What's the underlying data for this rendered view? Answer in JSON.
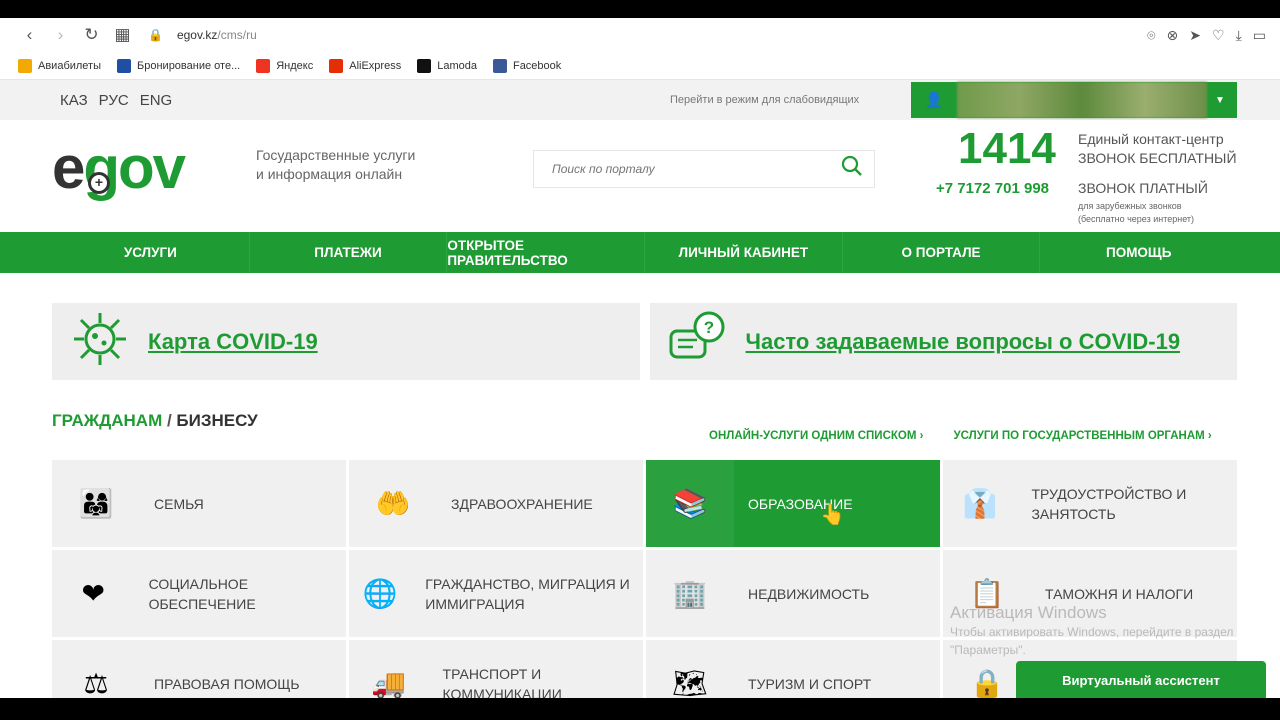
{
  "browser": {
    "url_host": "egov.kz",
    "url_path": "/cms/ru",
    "bookmarks": [
      {
        "label": "Авиабилеты",
        "icon": "plane-icon",
        "color": "#f2a900"
      },
      {
        "label": "Бронирование оте...",
        "icon": "booking-icon",
        "color": "#1e4fa3"
      },
      {
        "label": "Яндекс",
        "icon": "yandex-icon",
        "color": "#e32"
      },
      {
        "label": "AliExpress",
        "icon": "aliexpress-icon",
        "color": "#e62e04"
      },
      {
        "label": "Lamoda",
        "icon": "lamoda-icon",
        "color": "#111"
      },
      {
        "label": "Facebook",
        "icon": "facebook-icon",
        "color": "#3b5998"
      }
    ]
  },
  "topbar": {
    "languages": [
      "КАЗ",
      "РУС",
      "ENG"
    ],
    "low_vision": "Перейти в режим для слабовидящих"
  },
  "header": {
    "logo_e": "e",
    "logo_gov": "gov",
    "tagline_1": "Государственные услуги",
    "tagline_2": "и информация онлайн",
    "search_placeholder": "Поиск по порталу",
    "hotline": "1414",
    "hotline_desc_1": "Единый контакт-центр",
    "hotline_desc_2": "ЗВОНОК БЕСПЛАТНЫЙ",
    "paid_phone": "+7 7172 701 998",
    "paid_desc": "ЗВОНОК ПЛАТНЫЙ",
    "paid_note_1": "для зарубежных звонков",
    "paid_note_2": "(бесплатно через интернет)"
  },
  "nav": [
    "УСЛУГИ",
    "ПЛАТЕЖИ",
    "ОТКРЫТОЕ ПРАВИТЕЛЬСТВО",
    "ЛИЧНЫЙ КАБИНЕТ",
    "О ПОРТАЛЕ",
    "ПОМОЩЬ"
  ],
  "covid": {
    "map_label": "Карта COVID-19",
    "faq_label": "Часто задаваемые вопросы о COVID-19"
  },
  "section": {
    "title_a": "ГРАЖДАНАМ",
    "sep": " / ",
    "title_b": "БИЗНЕСУ",
    "link_1": "ОНЛАЙН-УСЛУГИ ОДНИМ СПИСКОМ ›",
    "link_2": "УСЛУГИ ПО ГОСУДАРСТВЕННЫМ ОРГАНАМ ›"
  },
  "categories": [
    {
      "label": "Семья",
      "icon": "family-icon",
      "glyph": "👨‍👩‍👧"
    },
    {
      "label": "Здравоохранение",
      "icon": "health-icon",
      "glyph": "🤲"
    },
    {
      "label": "Образование",
      "icon": "books-icon",
      "glyph": "📚",
      "active": true
    },
    {
      "label": "Трудоустройство и занятость",
      "icon": "worker-icon",
      "glyph": "👔"
    },
    {
      "label": "Социальное обеспечение",
      "icon": "social-icon",
      "glyph": "❤"
    },
    {
      "label": "Гражданство, миграция и иммиграция",
      "icon": "globe-people-icon",
      "glyph": "🌐"
    },
    {
      "label": "Недвижимость",
      "icon": "building-icon",
      "glyph": "🏢"
    },
    {
      "label": "Таможня и налоги",
      "icon": "customs-icon",
      "glyph": "📋"
    },
    {
      "label": "Правовая помощь",
      "icon": "scales-icon",
      "glyph": "⚖"
    },
    {
      "label": "Транспорт и коммуникации",
      "icon": "truck-icon",
      "glyph": "🚚"
    },
    {
      "label": "Туризм и спорт",
      "icon": "tourism-icon",
      "glyph": "🗺"
    },
    {
      "label": "",
      "icon": "shield-lock-icon",
      "glyph": "🔒"
    }
  ],
  "windows": {
    "title": "Активация Windows",
    "body": "Чтобы активировать Windows, перейдите в раздел \"Параметры\"."
  },
  "assistant": "Виртуальный ассистент",
  "colors": {
    "brand": "#1e9b33",
    "tile_bg": "#f0f0f0"
  }
}
